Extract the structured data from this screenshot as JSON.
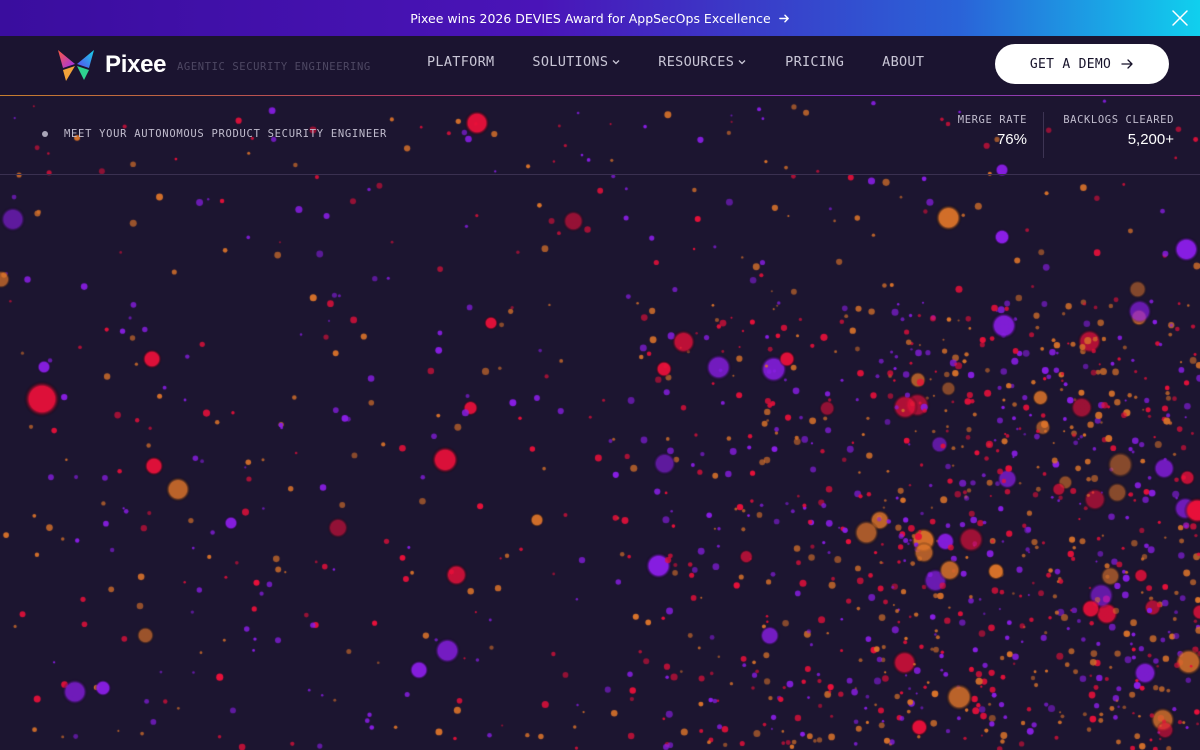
{
  "banner": {
    "text": "Pixee wins 2026 DEVIES Award for AppSecOps Excellence",
    "arrow_icon": "arrow-right-icon",
    "close_icon": "close-icon"
  },
  "brand": {
    "name": "Pixee",
    "tagline": "AGENTIC SECURITY ENGINEERING"
  },
  "nav": {
    "items": [
      {
        "label": "PLATFORM",
        "dropdown": false
      },
      {
        "label": "SOLUTIONS",
        "dropdown": true
      },
      {
        "label": "RESOURCES",
        "dropdown": true
      },
      {
        "label": "PRICING",
        "dropdown": false
      },
      {
        "label": "ABOUT",
        "dropdown": false
      }
    ],
    "cta_label": "GET A DEMO"
  },
  "hero": {
    "eyebrow": "MEET YOUR AUTONOMOUS PRODUCT SECURITY ENGINEER"
  },
  "stats": {
    "merge_rate": {
      "label": "MERGE RATE",
      "value": "76%"
    },
    "backlogs": {
      "label": "BACKLOGS CLEARED",
      "value": "5,200+"
    }
  },
  "colors": {
    "background": "#1c1530",
    "particle_red": "#e8103a",
    "particle_purple": "#8a1ee6",
    "particle_orange": "#d8722a"
  }
}
